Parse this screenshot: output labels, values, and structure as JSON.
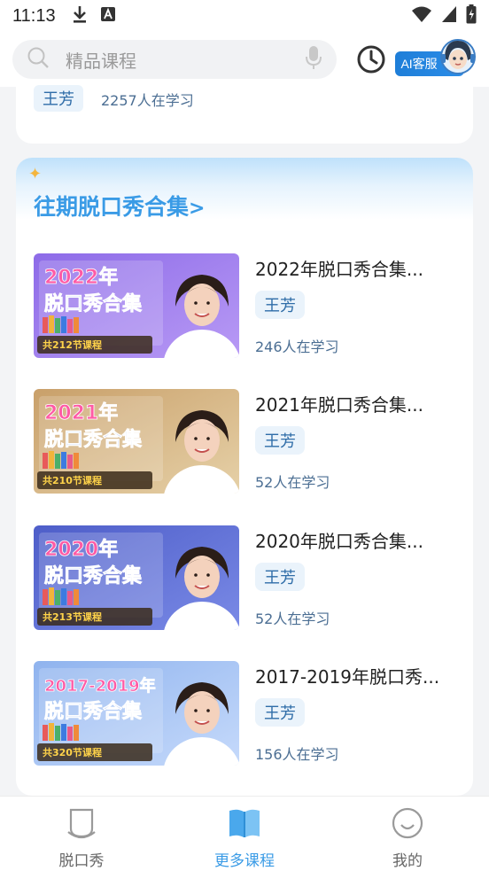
{
  "status_bar": {
    "time": "11:13"
  },
  "search": {
    "placeholder": "精品课程"
  },
  "ai_service": {
    "label": "AI客服"
  },
  "prev_item": {
    "teacher": "王芳",
    "learners": "2257人在学习"
  },
  "section": {
    "title": "往期脱口秀合集",
    "arrow": ">"
  },
  "courses": [
    {
      "title": "2022年脱口秀合集...",
      "teacher": "王芳",
      "learners": "246人在学习",
      "thumb": {
        "year": "2022年",
        "name": "脱口秀合集",
        "lessons": "共212节课程",
        "bg1": "#8d6be8",
        "bg2": "#b89af5"
      }
    },
    {
      "title": "2021年脱口秀合集...",
      "teacher": "王芳",
      "learners": "52人在学习",
      "thumb": {
        "year": "2021年",
        "name": "脱口秀合集",
        "lessons": "共210节课程",
        "bg1": "#c9a06a",
        "bg2": "#e6d1a8"
      }
    },
    {
      "title": "2020年脱口秀合集...",
      "teacher": "王芳",
      "learners": "52人在学习",
      "thumb": {
        "year": "2020年",
        "name": "脱口秀合集",
        "lessons": "共213节课程",
        "bg1": "#4e5ec9",
        "bg2": "#7a8ae6"
      }
    },
    {
      "title": "2017-2019年脱口秀...",
      "teacher": "王芳",
      "learners": "156人在学习",
      "thumb": {
        "year": "2017-2019年",
        "name": "脱口秀合集",
        "lessons": "共320节课程",
        "bg1": "#8fb3ee",
        "bg2": "#c6dafb"
      }
    }
  ],
  "bottom_nav": [
    {
      "label": "脱口秀",
      "icon": "talkshow-icon",
      "active": false
    },
    {
      "label": "更多课程",
      "icon": "courses-book-icon",
      "active": true
    },
    {
      "label": "我的",
      "icon": "profile-smile-icon",
      "active": false
    }
  ],
  "colors": {
    "accent": "#3a9be6",
    "tag_bg": "#eaf3fb",
    "tag_text": "#2f6da8"
  }
}
